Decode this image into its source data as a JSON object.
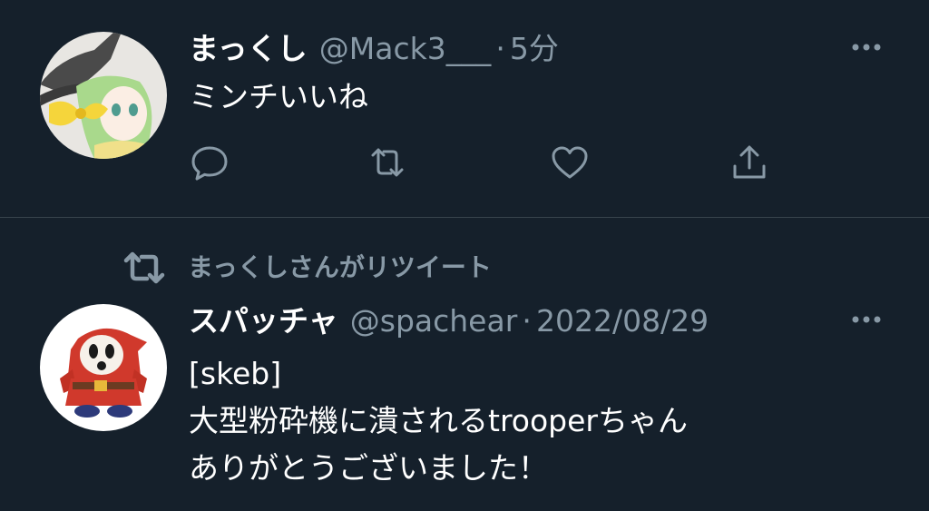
{
  "tweets": [
    {
      "display_name": "まっくし",
      "handle": "@Mack3___",
      "separator": "·",
      "time": "5分",
      "lines": [
        "ミンチいいね"
      ]
    },
    {
      "social_context": "まっくしさんがリツイート",
      "display_name": "スパッチャ",
      "handle": "@spachear",
      "separator": "·",
      "time": "2022/08/29",
      "lines": [
        "[skeb]",
        "大型粉砕機に潰されるtrooperちゃん",
        "ありがとうございました！"
      ]
    }
  ],
  "icons": {
    "more": "more-horizontal-icon",
    "reply": "reply-icon",
    "retweet": "retweet-icon",
    "like": "heart-icon",
    "share": "share-icon"
  },
  "colors": {
    "background": "#15202b",
    "primary_text": "#ffffff",
    "secondary_text": "#8899a6",
    "divider": "#38444d"
  }
}
